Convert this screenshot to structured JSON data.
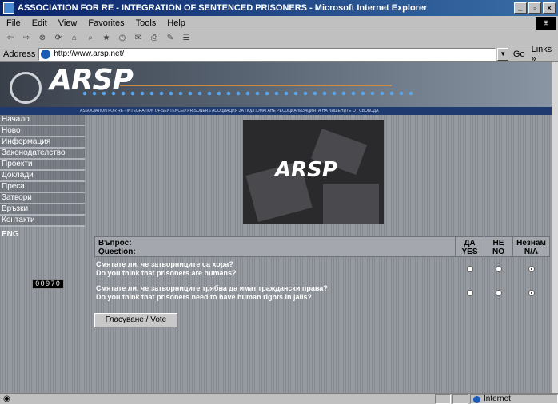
{
  "window": {
    "title": "ASSOCIATION FOR RE - INTEGRATION OF SENTENCED PRISONERS - Microsoft Internet Explorer",
    "buttons": [
      "_",
      "▫",
      "×"
    ]
  },
  "menu": [
    "File",
    "Edit",
    "View",
    "Favorites",
    "Tools",
    "Help"
  ],
  "address": {
    "label": "Address",
    "url": "http://www.arsp.net/",
    "go": "Go",
    "links": "Links »"
  },
  "banner": {
    "logo": "ARSP",
    "tagline": "ASSOCIATION FOR RE - INTEGRATION OF SENTENCED PRISONERS      АСОЦИАЦИЯ ЗА ПОДПОМАГАНЕ РЕСОЦИАЛИЗАЦИЯТА НА ЛИШЕНИТЕ ОТ СВОБОДА"
  },
  "nav": [
    "Начало",
    "Ново",
    "Информация",
    "Законодателство",
    "Проекти",
    "Доклади",
    "Преса",
    "Затвори",
    "Връзки",
    "Контакти"
  ],
  "lang": "ENG",
  "counter": "00970",
  "hero": "ARSP",
  "poll": {
    "header_bg": "Въпрос:",
    "header_en": "Question:",
    "cols": [
      {
        "bg": "ДА",
        "en": "YES"
      },
      {
        "bg": "НЕ",
        "en": "NO"
      },
      {
        "bg": "Незнам",
        "en": "N/A"
      }
    ],
    "questions": [
      {
        "bg": "Смятате ли, че затворниците са хора?",
        "en": "Do you think that prisoners are humans?",
        "selected": "N/A"
      },
      {
        "bg": "Смятате ли, че затворниците трябва да имат граждански права?",
        "en": "Do you think that prisoners need to have human rights in jails?",
        "selected": "N/A"
      }
    ],
    "vote_label": "Гласуване / Vote"
  },
  "status": {
    "zone": "Internet"
  }
}
